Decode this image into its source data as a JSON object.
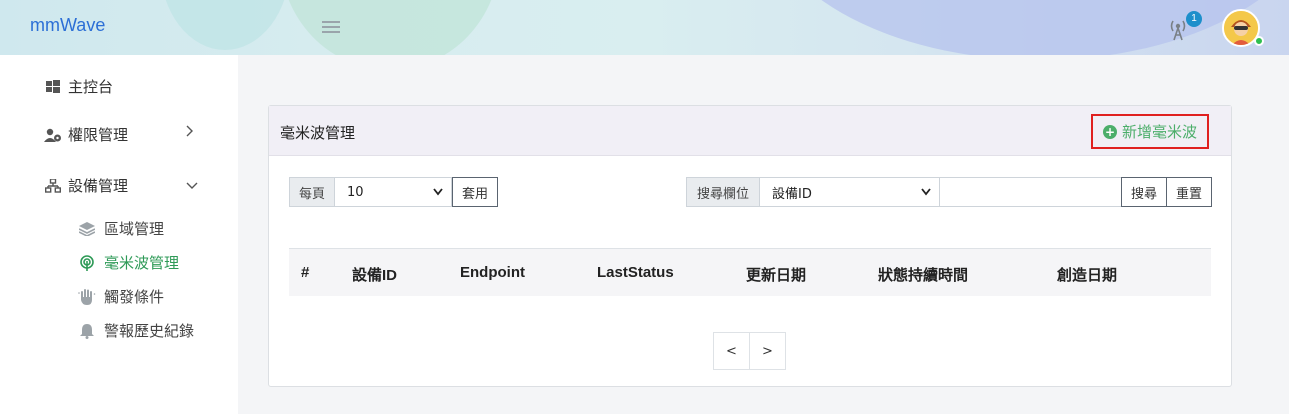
{
  "header": {
    "brand": "mmWave",
    "notification_count": "1"
  },
  "sidebar": {
    "items": [
      {
        "label": "主控台",
        "icon": "windows-icon"
      },
      {
        "label": "權限管理",
        "icon": "user-lock-icon",
        "chevron": "›"
      },
      {
        "label": "設備管理",
        "icon": "sitemap-icon",
        "chevron": "⌄"
      }
    ],
    "sub_items": [
      {
        "label": "區域管理",
        "icon": "layers-icon"
      },
      {
        "label": "毫米波管理",
        "icon": "radar-icon",
        "active": true
      },
      {
        "label": "觸發條件",
        "icon": "hand-icon"
      },
      {
        "label": "警報歷史紀錄",
        "icon": "bell-icon"
      }
    ]
  },
  "card": {
    "title": "毫米波管理",
    "add_label": "新增毫米波"
  },
  "controls": {
    "per_page_label": "每頁",
    "per_page_value": "10",
    "apply_label": "套用",
    "search_field_label": "搜尋欄位",
    "search_field_value": "設備ID",
    "search_input_value": "",
    "search_label": "搜尋",
    "reset_label": "重置"
  },
  "table": {
    "columns": [
      "#",
      "設備ID",
      "Endpoint",
      "LastStatus",
      "更新日期",
      "狀態持續時間",
      "創造日期"
    ]
  },
  "pagination": {
    "prev": "<",
    "next": ">"
  },
  "colors": {
    "brand": "#2c6fd6",
    "active_green": "#2e9a57",
    "add_green": "#4cae6a",
    "highlight_red": "#e0201f"
  }
}
